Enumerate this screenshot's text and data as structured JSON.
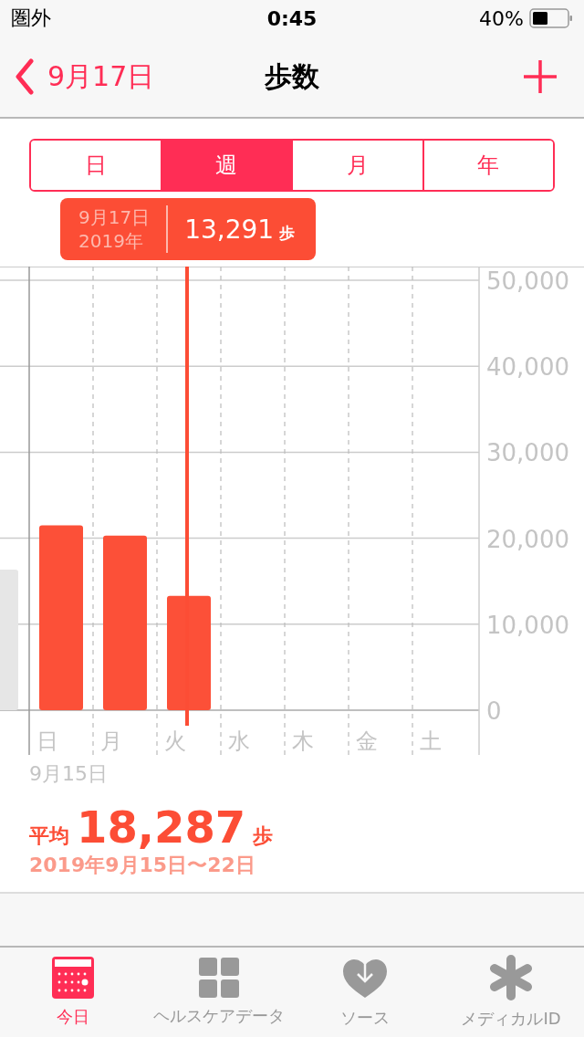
{
  "status_bar": {
    "carrier": "圏外",
    "time": "0:45",
    "battery": "40%"
  },
  "nav": {
    "back": "9月17日",
    "title": "歩数"
  },
  "segments": [
    {
      "label": "日",
      "selected": false
    },
    {
      "label": "週",
      "selected": true
    },
    {
      "label": "月",
      "selected": false
    },
    {
      "label": "年",
      "selected": false
    }
  ],
  "tooltip": {
    "date": "9月17日",
    "year": "2019年",
    "value": "13,291",
    "unit": "歩"
  },
  "chart_data": {
    "type": "bar",
    "grid": true,
    "categories": [
      "日",
      "月",
      "火",
      "水",
      "木",
      "金",
      "土"
    ],
    "values": [
      21500,
      20300,
      13291,
      null,
      null,
      null,
      null
    ],
    "ylim": [
      0,
      50000
    ],
    "yticks": [
      {
        "value": 0,
        "label": "0"
      },
      {
        "value": 10000,
        "label": "10,000"
      },
      {
        "value": 20000,
        "label": "20,000"
      },
      {
        "value": 30000,
        "label": "30,000"
      },
      {
        "value": 40000,
        "label": "40,000"
      },
      {
        "value": 50000,
        "label": "50,000"
      }
    ]
  },
  "week_start": "9月15日",
  "summary": {
    "label": "平均",
    "value": "18,287",
    "unit": "歩",
    "range": "2019年9月15日〜22日"
  },
  "tab_bar": [
    {
      "label": "今日",
      "selected": true
    },
    {
      "label": "ヘルスケアデータ",
      "selected": false
    },
    {
      "label": "ソース",
      "selected": false
    },
    {
      "label": "メディカルID",
      "selected": false
    }
  ]
}
